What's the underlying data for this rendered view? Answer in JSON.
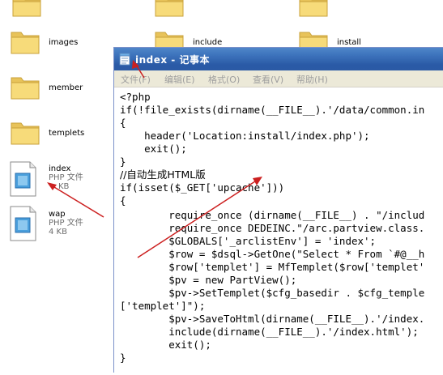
{
  "explorer": {
    "folders": [
      {
        "label": "images"
      },
      {
        "label": "member"
      },
      {
        "label": "templets"
      },
      {
        "label": "include"
      },
      {
        "label": "install"
      }
    ],
    "files": [
      {
        "name": "index",
        "type": "PHP 文件",
        "size": "KB"
      },
      {
        "name": "wap",
        "type": "PHP 文件",
        "size": "4 KB"
      }
    ]
  },
  "notepad": {
    "title": "index - 记事本",
    "menu": [
      "文件(F)",
      "编辑(E)",
      "格式(O)",
      "查看(V)",
      "帮助(H)"
    ],
    "code_lines": [
      "<?php",
      "if(!file_exists(dirname(__FILE__).'/data/common.in",
      "{",
      "    header('Location:install/index.php');",
      "    exit();",
      "}",
      "//自动生成HTML版",
      "if(isset($_GET['upcache']))",
      "{",
      "        require_once (dirname(__FILE__) . \"/includ",
      "        require_once DEDEINC.\"/arc.partview.class.",
      "        $GLOBALS['_arclistEnv'] = 'index';",
      "        $row = $dsql->GetOne(\"Select * From `#@__h",
      "        $row['templet'] = MfTemplet($row['templet'",
      "        $pv = new PartView();",
      "        $pv->SetTemplet($cfg_basedir . $cfg_temple",
      "['templet']\");",
      "        $pv->SaveToHtml(dirname(__FILE__).'/index.",
      "        include(dirname(__FILE__).'/index.html');",
      "        exit();",
      "}"
    ]
  },
  "colors": {
    "titlebar": "#2a5aa6",
    "menubar": "#ece9d8",
    "folder": "#f4d36a",
    "annotation_arrow": "#cc2020"
  }
}
